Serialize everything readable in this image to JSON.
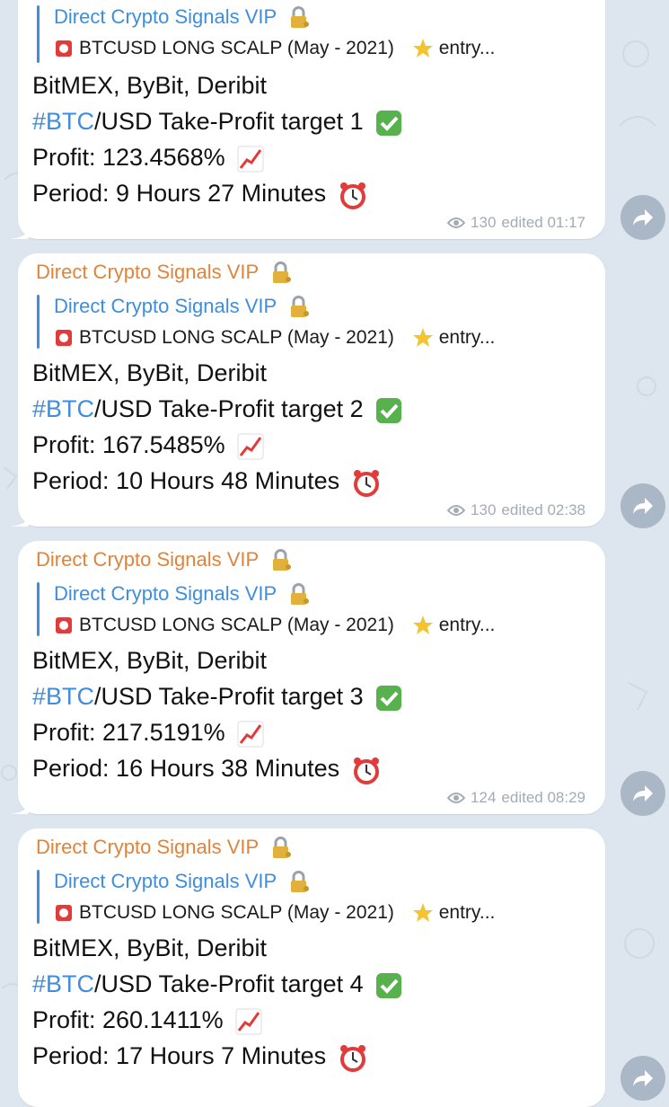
{
  "messages": [
    {
      "sender": "",
      "quote_title": "Direct Crypto Signals VIP",
      "quote_text": "BTCUSD LONG SCALP (May - 2021)",
      "quote_tail": "entry...",
      "exchanges": "BitMEX, ByBit, Deribit",
      "hashtag": "#BTC",
      "target_text": "/USD Take-Profit target 1",
      "profit": "Profit: 123.4568%",
      "period": "Period: 9 Hours 27 Minutes",
      "views": "130",
      "edited": "edited 01:17"
    },
    {
      "sender": "Direct Crypto Signals VIP",
      "quote_title": "Direct Crypto Signals VIP",
      "quote_text": "BTCUSD LONG SCALP (May - 2021)",
      "quote_tail": "entry...",
      "exchanges": "BitMEX, ByBit, Deribit",
      "hashtag": "#BTC",
      "target_text": "/USD Take-Profit target 2",
      "profit": "Profit: 167.5485%",
      "period": "Period: 10 Hours 48 Minutes",
      "views": "130",
      "edited": "edited 02:38"
    },
    {
      "sender": "Direct Crypto Signals VIP",
      "quote_title": "Direct Crypto Signals VIP",
      "quote_text": "BTCUSD LONG SCALP (May - 2021)",
      "quote_tail": "entry...",
      "exchanges": "BitMEX, ByBit, Deribit",
      "hashtag": "#BTC",
      "target_text": "/USD Take-Profit target 3",
      "profit": "Profit: 217.5191%",
      "period": "Period: 16 Hours 38 Minutes",
      "views": "124",
      "edited": "edited 08:29"
    },
    {
      "sender": "Direct Crypto Signals VIP",
      "quote_title": "Direct Crypto Signals VIP",
      "quote_text": "BTCUSD LONG SCALP (May - 2021)",
      "quote_tail": "entry...",
      "exchanges": "BitMEX, ByBit, Deribit",
      "hashtag": "#BTC",
      "target_text": "/USD Take-Profit target 4",
      "profit": "Profit: 260.1411%",
      "period": "Period: 17 Hours 7 Minutes",
      "views": "",
      "edited": ""
    }
  ],
  "icons": {
    "lock": "lock-with-key-icon",
    "siren": "siren-icon",
    "star": "star-icon",
    "check": "check-mark-icon",
    "chart": "chart-increasing-icon",
    "clock": "alarm-clock-icon",
    "eye": "eye-icon",
    "forward": "forward-arrow-icon"
  },
  "colors": {
    "sender": "#e0843a",
    "link": "#3d8ee0",
    "background": "#dde5ee",
    "bubble": "#ffffff",
    "meta": "#a3abb3"
  }
}
